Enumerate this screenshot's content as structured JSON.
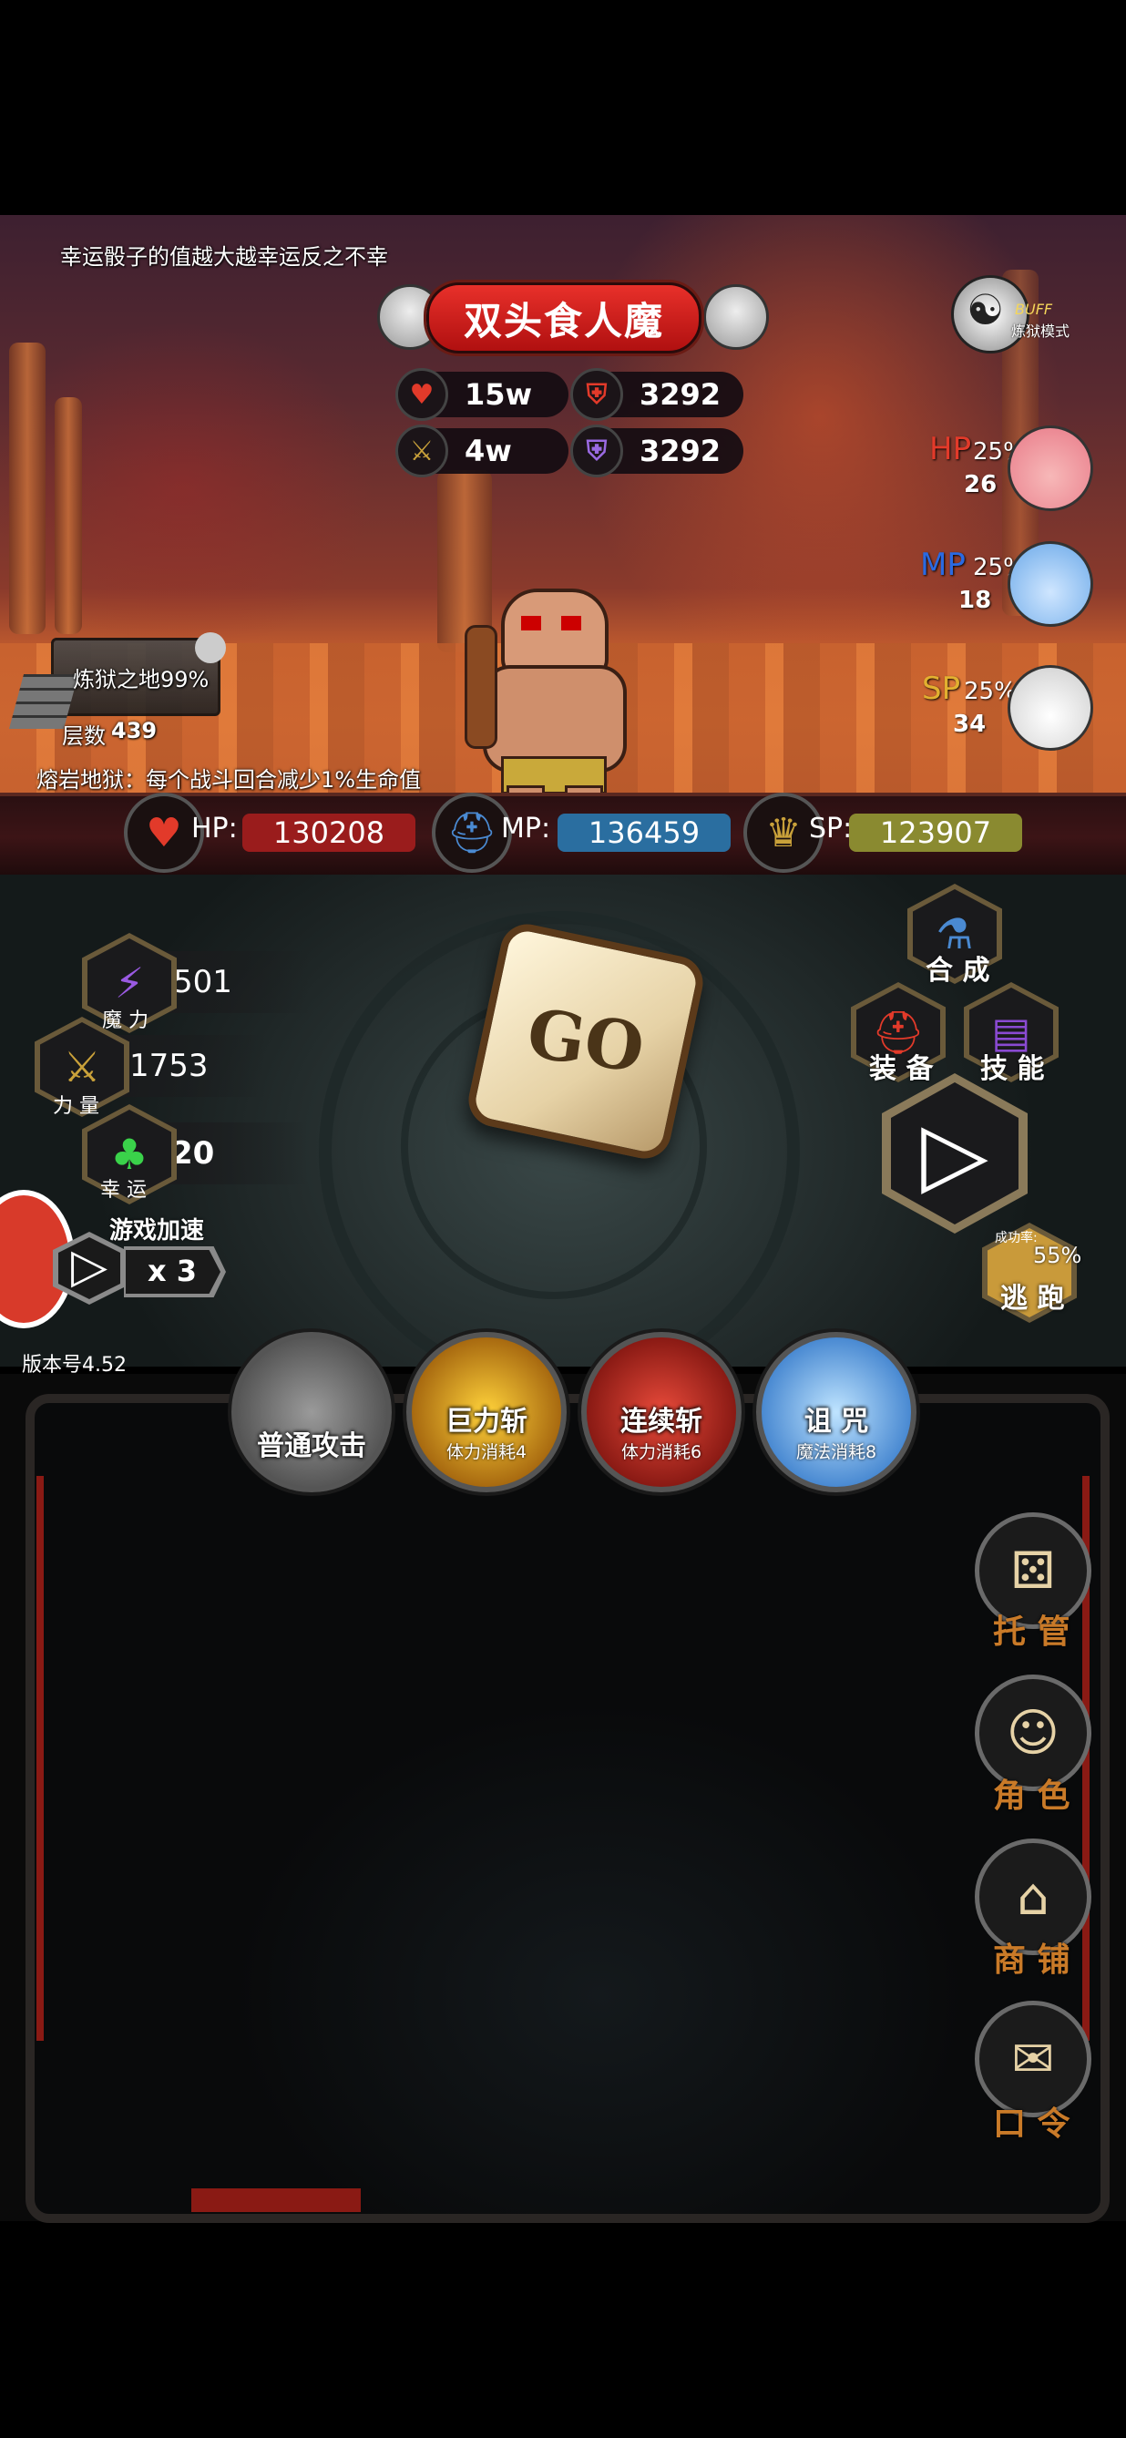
{
  "scene": {
    "hint": "幸运骰子的值越大越幸运反之不幸",
    "boss_name": "双头食人魔",
    "stats": {
      "hp": "15w",
      "def": "3292",
      "atk": "4w",
      "mdef": "3292"
    },
    "buff_badge": "BUFF",
    "buff_mode": "炼狱模式",
    "potions": [
      {
        "type": "HP",
        "pct": "25%",
        "count": "26",
        "color": "#e23a2a"
      },
      {
        "type": "MP",
        "pct": "25%",
        "count": "18",
        "color": "#2a6ae2"
      },
      {
        "type": "SP",
        "pct": "25%",
        "count": "34",
        "color": "#e2b030"
      }
    ],
    "floor_progress": "炼狱之地99%",
    "floor_label": "层数",
    "floor_value": "439",
    "terrain_effect": "熔岩地狱：每个战斗回合减少1%生命值"
  },
  "resources": {
    "hp_label": "HP:",
    "hp_value": "130208",
    "mp_label": "MP:",
    "mp_value": "136459",
    "sp_label": "SP:",
    "sp_value": "123907"
  },
  "attributes": {
    "magic_value": "501",
    "magic_label": "魔 力",
    "power_value": "1753",
    "power_label": "力 量",
    "luck_value": "20",
    "luck_label": "幸 运"
  },
  "speed": {
    "label": "游戏加速",
    "value": "x 3"
  },
  "version": "版本号4.52",
  "dice_label": "GO",
  "actions": {
    "synth": "合 成",
    "equip": "装 备",
    "skill": "技 能"
  },
  "escape": {
    "rate_label": "成功率:",
    "rate": "55%",
    "label": "逃 跑"
  },
  "skills": [
    {
      "name": "普通攻击",
      "cost": ""
    },
    {
      "name": "巨力斩",
      "cost": "体力消耗4"
    },
    {
      "name": "连续斩",
      "cost": "体力消耗6"
    },
    {
      "name": "诅 咒",
      "cost": "魔法消耗8"
    }
  ],
  "menu": {
    "auto": "托 管",
    "role": "角 色",
    "shop": "商 铺",
    "code": "口 令"
  }
}
